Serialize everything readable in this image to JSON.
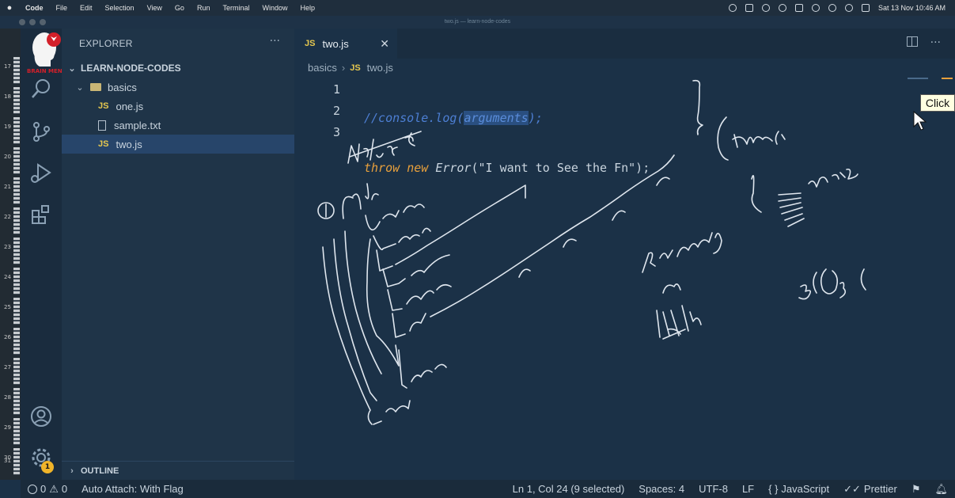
{
  "menubar": {
    "items": [
      "Code",
      "File",
      "Edit",
      "Selection",
      "View",
      "Go",
      "Run",
      "Terminal",
      "Window",
      "Help"
    ],
    "clock": "Sat 13 Nov  10:46 AM"
  },
  "window_title": "two.js — learn-node-codes",
  "filmstrip": {
    "numbers": [
      "17",
      "18",
      "19",
      "20",
      "21",
      "22",
      "23",
      "24",
      "25",
      "26",
      "27",
      "28",
      "29",
      "30",
      "31"
    ]
  },
  "logo_text": "BRAIN MENTORS",
  "activity": {
    "badge_count": "1"
  },
  "sidebar": {
    "header": "EXPLORER",
    "more": "···",
    "project": "LEARN-NODE-CODES",
    "folder": "basics",
    "files": [
      {
        "badge": "JS",
        "name": "one.js"
      },
      {
        "badge": "",
        "name": "sample.txt"
      },
      {
        "badge": "JS",
        "name": "two.js"
      }
    ],
    "outline": "OUTLINE"
  },
  "editor": {
    "tab": {
      "badge": "JS",
      "label": "two.js",
      "close": "✕"
    },
    "breadcrumb": {
      "folder": "basics",
      "file_badge": "JS",
      "file": "two.js"
    },
    "line_numbers": [
      "1",
      "2",
      "3"
    ],
    "code": {
      "line1_prefix": "//console.log(",
      "line1_selected": "arguments",
      "line1_suffix": ");",
      "line2_throw": "throw",
      "line2_new": "new",
      "line2_error": "Error",
      "line2_rest": "(\"I want to See the Fn\");"
    },
    "accent_color": "#e8a03c"
  },
  "tooltip": "Click",
  "statusbar": {
    "errors": "0",
    "warnings": "0",
    "auto_attach": "Auto Attach: With Flag",
    "position": "Ln 1, Col 24 (9 selected)",
    "spaces": "Spaces: 4",
    "encoding": "UTF-8",
    "eol": "LF",
    "language": "JavaScript",
    "formatter": "Prettier"
  }
}
